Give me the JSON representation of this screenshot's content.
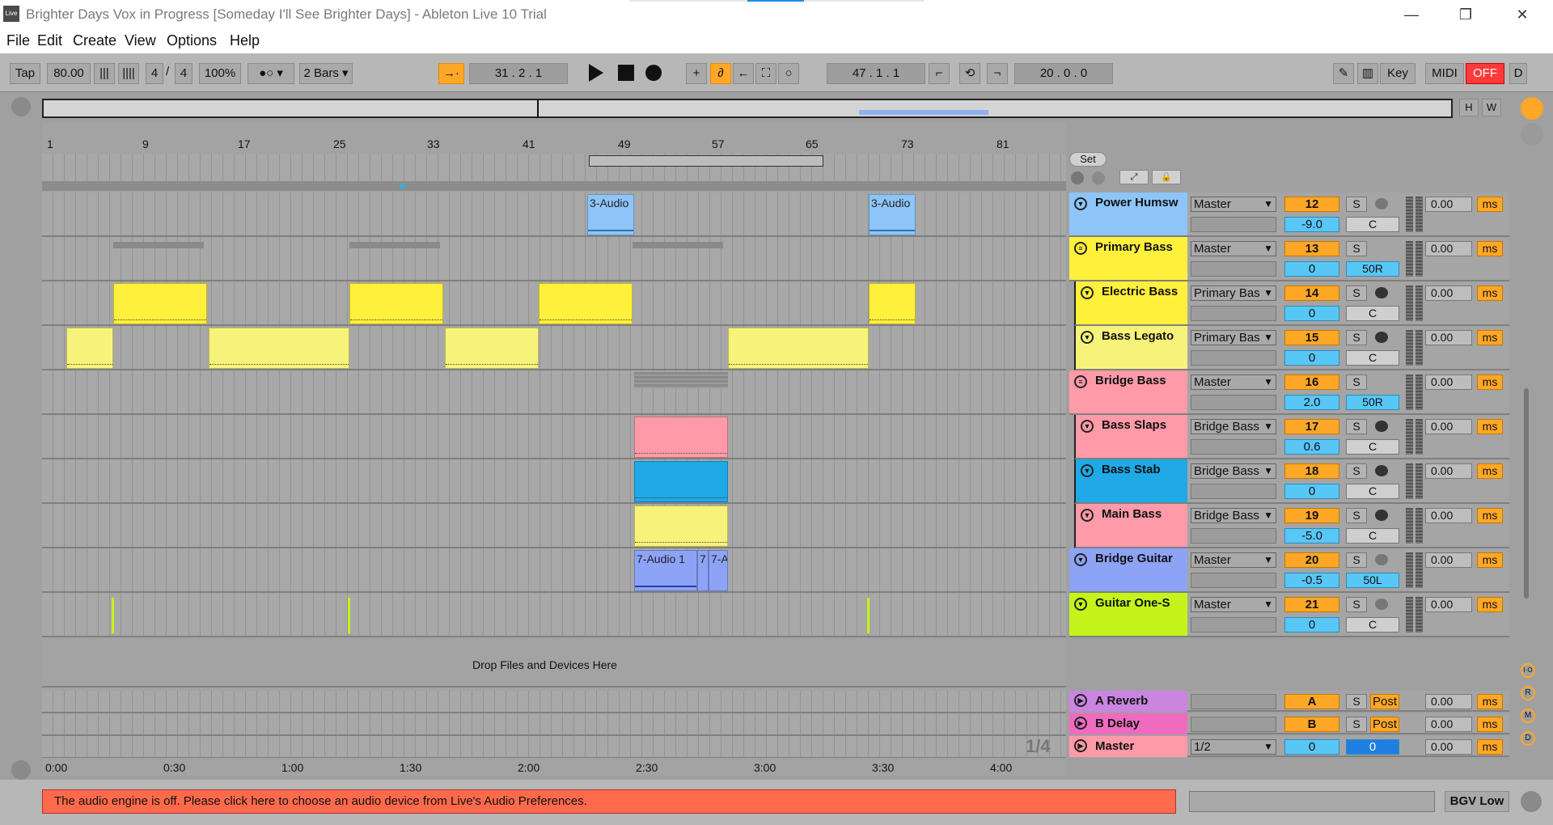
{
  "window": {
    "title": "Brighter Days Vox in Progress  [Someday I'll See Brighter Days] - Ableton Live 10 Trial",
    "logo": "Live",
    "min": "—",
    "restore": "❐",
    "close": "✕"
  },
  "menu": [
    "File",
    "Edit",
    "Create",
    "View",
    "Options",
    "Help"
  ],
  "transport": {
    "tap": "Tap",
    "tempo": "80.00",
    "time_sig_num": "4",
    "time_sig_slash": "/",
    "time_sig_den": "4",
    "zoom": "100%",
    "quantize": "2 Bars",
    "position": "31 .   2 .   1",
    "loop_start": "47 .   1 .   1",
    "loop_length": "20 .   0 .   0",
    "key": "Key",
    "midi": "MIDI",
    "off": "OFF",
    "d": "D"
  },
  "overview": {
    "h": "H",
    "w": "W"
  },
  "ruler": [
    "1",
    "9",
    "17",
    "25",
    "33",
    "41",
    "49",
    "57",
    "65",
    "73",
    "81"
  ],
  "set_label": "Set",
  "tracks": [
    {
      "name": "Power Humsw",
      "color": "#8ec5f8",
      "type": "audio",
      "route": "Master",
      "num": "12",
      "vol": "-9.0",
      "pan": "C",
      "delay": "0.00",
      "clips": [
        {
          "label": "3-Audio"
        },
        {
          "label": "3-Audio"
        }
      ]
    },
    {
      "name": "Primary Bass",
      "color": "#fff03c",
      "type": "group",
      "route": "Master",
      "num": "13",
      "vol": "0",
      "pan": "50R",
      "delay": "0.00"
    },
    {
      "name": "Electric Bass",
      "color": "#fff03c",
      "type": "midi",
      "route": "Primary Bas",
      "num": "14",
      "vol": "0",
      "pan": "C",
      "delay": "0.00"
    },
    {
      "name": "Bass Legato",
      "color": "#f7f37a",
      "type": "midi",
      "route": "Primary Bas",
      "num": "15",
      "vol": "0",
      "pan": "C",
      "delay": "0.00"
    },
    {
      "name": "Bridge Bass",
      "color": "#ff9aa8",
      "type": "group",
      "route": "Master",
      "num": "16",
      "vol": "2.0",
      "pan": "50R",
      "delay": "0.00"
    },
    {
      "name": "Bass Slaps",
      "color": "#ff9aa8",
      "type": "midi",
      "route": "Bridge Bass",
      "num": "17",
      "vol": "0.6",
      "pan": "C",
      "delay": "0.00"
    },
    {
      "name": "Bass Stab",
      "color": "#1fa9e6",
      "type": "midi",
      "route": "Bridge Bass",
      "num": "18",
      "vol": "0",
      "pan": "C",
      "delay": "0.00"
    },
    {
      "name": "Main Bass",
      "color": "#ff9aa8",
      "type": "midi",
      "route": "Bridge Bass",
      "num": "19",
      "vol": "-5.0",
      "pan": "C",
      "delay": "0.00"
    },
    {
      "name": "Bridge Guitar",
      "color": "#8da3f5",
      "type": "audio",
      "route": "Master",
      "num": "20",
      "vol": "-0.5",
      "pan": "50L",
      "delay": "0.00",
      "clips": [
        {
          "label": "7-Audio 1"
        },
        {
          "label": "7"
        },
        {
          "label": "7-A"
        }
      ]
    },
    {
      "name": "Guitar One-S",
      "color": "#c4f41a",
      "type": "audio",
      "route": "Master",
      "num": "21",
      "vol": "0",
      "pan": "C",
      "delay": "0.00"
    }
  ],
  "drop_text": "Drop Files and Devices Here",
  "returns": [
    {
      "name": "A Reverb",
      "color": "#c985e0",
      "letter": "A",
      "solo": "S",
      "post": "Post",
      "delay": "0.00"
    },
    {
      "name": "B Delay",
      "color": "#f06ac0",
      "letter": "B",
      "solo": "S",
      "post": "Post",
      "delay": "0.00"
    }
  ],
  "master": {
    "name": "Master",
    "color": "#ff9aa8",
    "route": "1/2",
    "vol": "0",
    "pan": "0",
    "delay": "0.00"
  },
  "solo_label": "S",
  "ms_label": "ms",
  "page_indicator": "1/4",
  "time_ruler": [
    "0:00",
    "0:30",
    "1:00",
    "1:30",
    "2:00",
    "2:30",
    "3:00",
    "3:30",
    "4:00"
  ],
  "status_message": "The audio engine is off. Please click here to choose an audio device from Live's Audio Preferences.",
  "bottom_right": "BGV Low",
  "side_letters": [
    "I·O",
    "R",
    "M",
    "D"
  ]
}
